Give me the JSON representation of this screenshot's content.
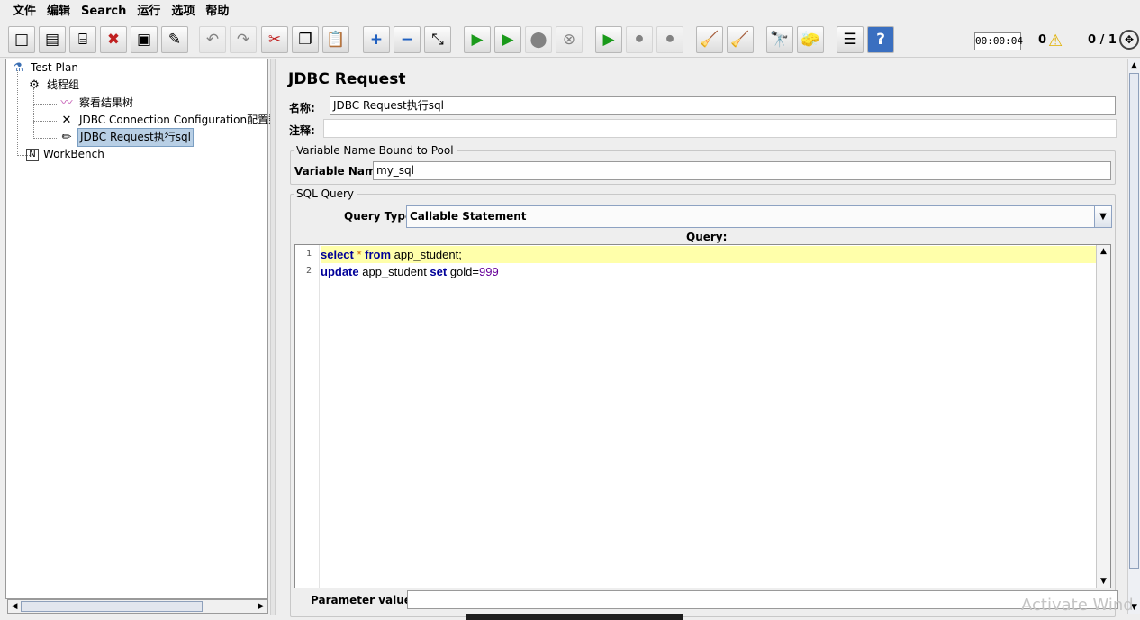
{
  "menu": [
    "文件",
    "编辑",
    "Search",
    "运行",
    "选项",
    "帮助"
  ],
  "toolbar": {
    "buttons": [
      {
        "name": "new-icon",
        "glyph": "□"
      },
      {
        "name": "templates-icon",
        "glyph": "▤"
      },
      {
        "name": "open-icon",
        "glyph": "⌸"
      },
      {
        "name": "close-icon",
        "glyph": "✖"
      },
      {
        "name": "save-icon",
        "glyph": "▣"
      },
      {
        "name": "save-as-icon",
        "glyph": "✎"
      },
      {
        "name": "undo-icon",
        "glyph": "↶"
      },
      {
        "name": "redo-icon",
        "glyph": "↷"
      },
      {
        "name": "cut-icon",
        "glyph": "✂"
      },
      {
        "name": "copy-icon",
        "glyph": "❐"
      },
      {
        "name": "paste-icon",
        "glyph": "📋"
      },
      {
        "name": "expand-icon",
        "glyph": "+"
      },
      {
        "name": "collapse-icon",
        "glyph": "−"
      },
      {
        "name": "toggle-icon",
        "glyph": "⤡"
      },
      {
        "name": "start-icon",
        "glyph": "▶"
      },
      {
        "name": "start-no-pauses-icon",
        "glyph": "▶"
      },
      {
        "name": "stop-icon",
        "glyph": "⬤"
      },
      {
        "name": "shutdown-icon",
        "glyph": "⊗"
      },
      {
        "name": "remote-start-icon",
        "glyph": "▶"
      },
      {
        "name": "remote-stop-icon",
        "glyph": "⚫"
      },
      {
        "name": "remote-shutdown-icon",
        "glyph": "⚫"
      },
      {
        "name": "clear-icon",
        "glyph": "🧹"
      },
      {
        "name": "clear-all-icon",
        "glyph": "🧹"
      },
      {
        "name": "search-icon",
        "glyph": "🔭"
      },
      {
        "name": "reset-search-icon",
        "glyph": "🧽"
      },
      {
        "name": "function-helper-icon",
        "glyph": "☰"
      },
      {
        "name": "help-icon",
        "glyph": "?"
      }
    ],
    "timer": "00:00:04",
    "warnings": "0",
    "threads": "0 / 1"
  },
  "tree": {
    "nodes": [
      "Test Plan",
      "线程组",
      "察看结果树",
      "JDBC Connection Configuration配置数",
      "JDBC Request执行sql",
      "WorkBench"
    ]
  },
  "panel": {
    "title": "JDBC Request",
    "name_label": "名称:",
    "name_value": "JDBC Request执行sql",
    "comment_label": "注释:",
    "comment_value": "",
    "pool_group_title": "Variable Name Bound to Pool",
    "variable_label": "Variable Name:",
    "variable_value": "my_sql",
    "sql_group_title": "SQL Query",
    "query_type_label": "Query Type:",
    "query_type_value": "Callable Statement",
    "query_label": "Query:",
    "line1_num": "1",
    "line2_num": "2",
    "line1": {
      "kw1": "select",
      "op1": " * ",
      "kw2": "from",
      "rest": " app_student;"
    },
    "line2": {
      "kw1": "update",
      "mid": " app_student ",
      "kw2": "set",
      "rest": " gold=",
      "num": "999"
    },
    "param_label": "Parameter values:",
    "param_value": ""
  },
  "watermark": "Activate Wind"
}
